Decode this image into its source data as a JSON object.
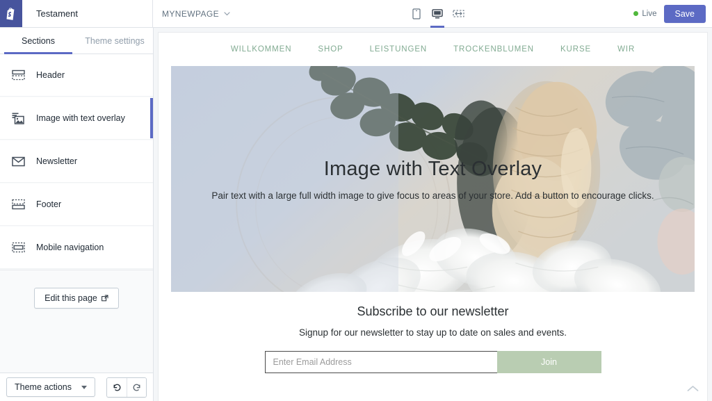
{
  "topbar": {
    "logo_icon": "shopify-bag-icon",
    "theme_name": "Testament",
    "page_name": "MYNEWPAGE",
    "page_caret_icon": "chevron-down-icon",
    "devices": [
      {
        "name": "mobile",
        "icon": "mobile-icon",
        "active": false
      },
      {
        "name": "desktop",
        "icon": "desktop-icon",
        "active": true
      },
      {
        "name": "full-width",
        "icon": "full-width-icon",
        "active": false
      }
    ],
    "live_label": "Live",
    "live_color": "#50b83c",
    "save_label": "Save",
    "save_color": "#5c6ac4"
  },
  "sidebar": {
    "tabs": [
      {
        "label": "Sections",
        "active": true
      },
      {
        "label": "Theme settings",
        "active": false
      }
    ],
    "sections": [
      {
        "label": "Header",
        "icon": "header-layout-icon",
        "selected": false
      },
      {
        "label": "Image with text overlay",
        "icon": "image-overlay-icon",
        "selected": true
      },
      {
        "label": "Newsletter",
        "icon": "envelope-icon",
        "selected": false
      },
      {
        "label": "Footer",
        "icon": "footer-layout-icon",
        "selected": false
      },
      {
        "label": "Mobile navigation",
        "icon": "mobile-nav-icon",
        "selected": false
      }
    ],
    "edit_page_label": "Edit this page",
    "edit_page_icon": "external-link-icon",
    "theme_actions_label": "Theme actions",
    "theme_actions_caret_icon": "caret-down-icon",
    "undo_icon": "undo-arrow-icon",
    "redo_icon": "redo-arrow-icon"
  },
  "preview": {
    "nav": [
      {
        "label": "WILLKOMMEN"
      },
      {
        "label": "SHOP"
      },
      {
        "label": "LEISTUNGEN"
      },
      {
        "label": "TROCKENBLUMEN"
      },
      {
        "label": "KURSE"
      },
      {
        "label": "WIR"
      }
    ],
    "nav_color": "#82ab92",
    "hero": {
      "title": "Image with Text Overlay",
      "subtitle": "Pair text with a large full width image to give focus to areas of your store. Add a button to encourage clicks."
    },
    "newsletter": {
      "title": "Subscribe to our newsletter",
      "subtitle": "Signup for our newsletter to stay up to date on sales and events.",
      "input_placeholder": "Enter Email Address",
      "join_label": "Join",
      "join_color": "#b9cdb2"
    },
    "collapse_icon": "chevron-up-icon"
  }
}
